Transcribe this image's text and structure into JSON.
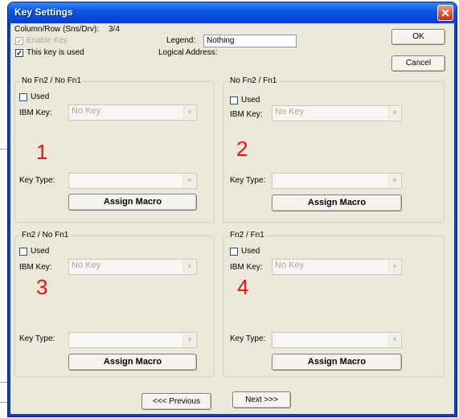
{
  "window": {
    "title": "Key Settings",
    "close_glyph": "✕"
  },
  "header": {
    "colrow_label": "Column/Row (Sns/Drv):",
    "colrow_value": "3/4",
    "enable_key_label": "Enable Key",
    "enable_key_checked": true,
    "key_used_label": "This key is used",
    "key_used_checked": true,
    "legend_label": "Legend:",
    "legend_value": "Nothing",
    "logical_address_label": "Logical Address:"
  },
  "buttons": {
    "ok": "OK",
    "cancel": "Cancel",
    "previous": "<<< Previous",
    "next": "Next >>>"
  },
  "groups": [
    {
      "title": "No Fn2 / No Fn1",
      "used_label": "Used",
      "ibm_key_label": "IBM Key:",
      "ibm_key_value": "No Key",
      "number": "1",
      "key_type_label": "Key Type:",
      "key_type_value": "",
      "assign_label": "Assign Macro"
    },
    {
      "title": "No Fn2 / Fn1",
      "used_label": "Used",
      "ibm_key_label": "IBM Key:",
      "ibm_key_value": "No Key",
      "number": "2",
      "key_type_label": "Key Type:",
      "key_type_value": "",
      "assign_label": "Assign Macro"
    },
    {
      "title": "Fn2 / No Fn1",
      "used_label": "Used",
      "ibm_key_label": "IBM Key:",
      "ibm_key_value": "No Key",
      "number": "3",
      "key_type_label": "Key Type:",
      "key_type_value": "",
      "assign_label": "Assign Macro"
    },
    {
      "title": "Fn2 / Fn1",
      "used_label": "Used",
      "ibm_key_label": "IBM Key:",
      "ibm_key_value": "No Key",
      "number": "4",
      "key_type_label": "Key Type:",
      "key_type_value": "",
      "assign_label": "Assign Macro"
    }
  ],
  "colors": {
    "title_bar": "#0a5ae0",
    "annotation_red": "#ee1111",
    "dialog_bg": "#ece9d8"
  }
}
